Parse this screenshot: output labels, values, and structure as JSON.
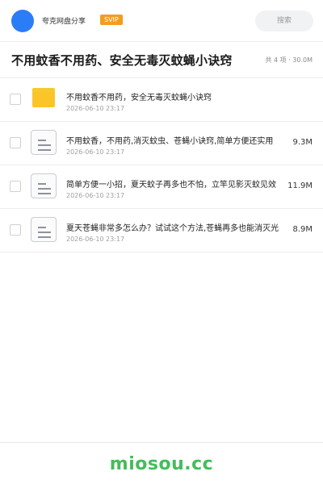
{
  "header": {
    "share_title": "夸克网盘分享",
    "badge": "SVIP",
    "search_label": "搜索",
    "accent_color": "#2b7cf7",
    "badge_color": "#f39c24"
  },
  "folder": {
    "title": "不用蚊香不用药、安全无毒灭蚊蝇小诀窍",
    "summary": "共 4 项 · 30.0M"
  },
  "files": [
    {
      "name": "不用蚊香不用药，安全无毒灭蚊蝇小诀窍",
      "date": "2026-06-10 23:17",
      "size": "",
      "type": "folder-icon"
    },
    {
      "name": "不用蚊香，不用药,消灭蚊虫、苍蝇小诀窍,简单方便还实用",
      "date": "2026-06-10 23:17",
      "size": "9.3M",
      "type": "document-icon"
    },
    {
      "name": "简单方便一小招，夏天蚊子再多也不怕，立竿见影灭蚊见效",
      "date": "2026-06-10 23:17",
      "size": "11.9M",
      "type": "document-icon"
    },
    {
      "name": "夏天苍蝇非常多怎么办？试试这个方法,苍蝇再多也能消灭光",
      "date": "2026-06-10 23:17",
      "size": "8.9M",
      "type": "document-icon"
    }
  ],
  "footer": {
    "watermark": "miosou.cc",
    "color": "#43bd5a"
  }
}
